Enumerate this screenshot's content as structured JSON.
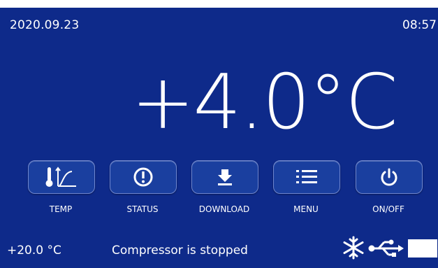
{
  "header": {
    "date": "2020.09.23",
    "time": "08:57"
  },
  "reading": {
    "temperature": "+4.0°C"
  },
  "buttons": [
    {
      "label": "TEMP",
      "icon": "thermometer-graph-icon"
    },
    {
      "label": "STATUS",
      "icon": "alert-icon"
    },
    {
      "label": "DOWNLOAD",
      "icon": "download-icon"
    },
    {
      "label": "MENU",
      "icon": "menu-list-icon"
    },
    {
      "label": "ON/OFF",
      "icon": "power-icon"
    }
  ],
  "footer": {
    "setpoint": "+20.0 °C",
    "status_text": "Compressor is stopped",
    "icons": [
      "snowflake-icon",
      "usb-icon",
      "battery-icon"
    ]
  },
  "colors": {
    "background": "#0e2a8a",
    "button": "#1a3f9f",
    "text": "#ffffff"
  }
}
